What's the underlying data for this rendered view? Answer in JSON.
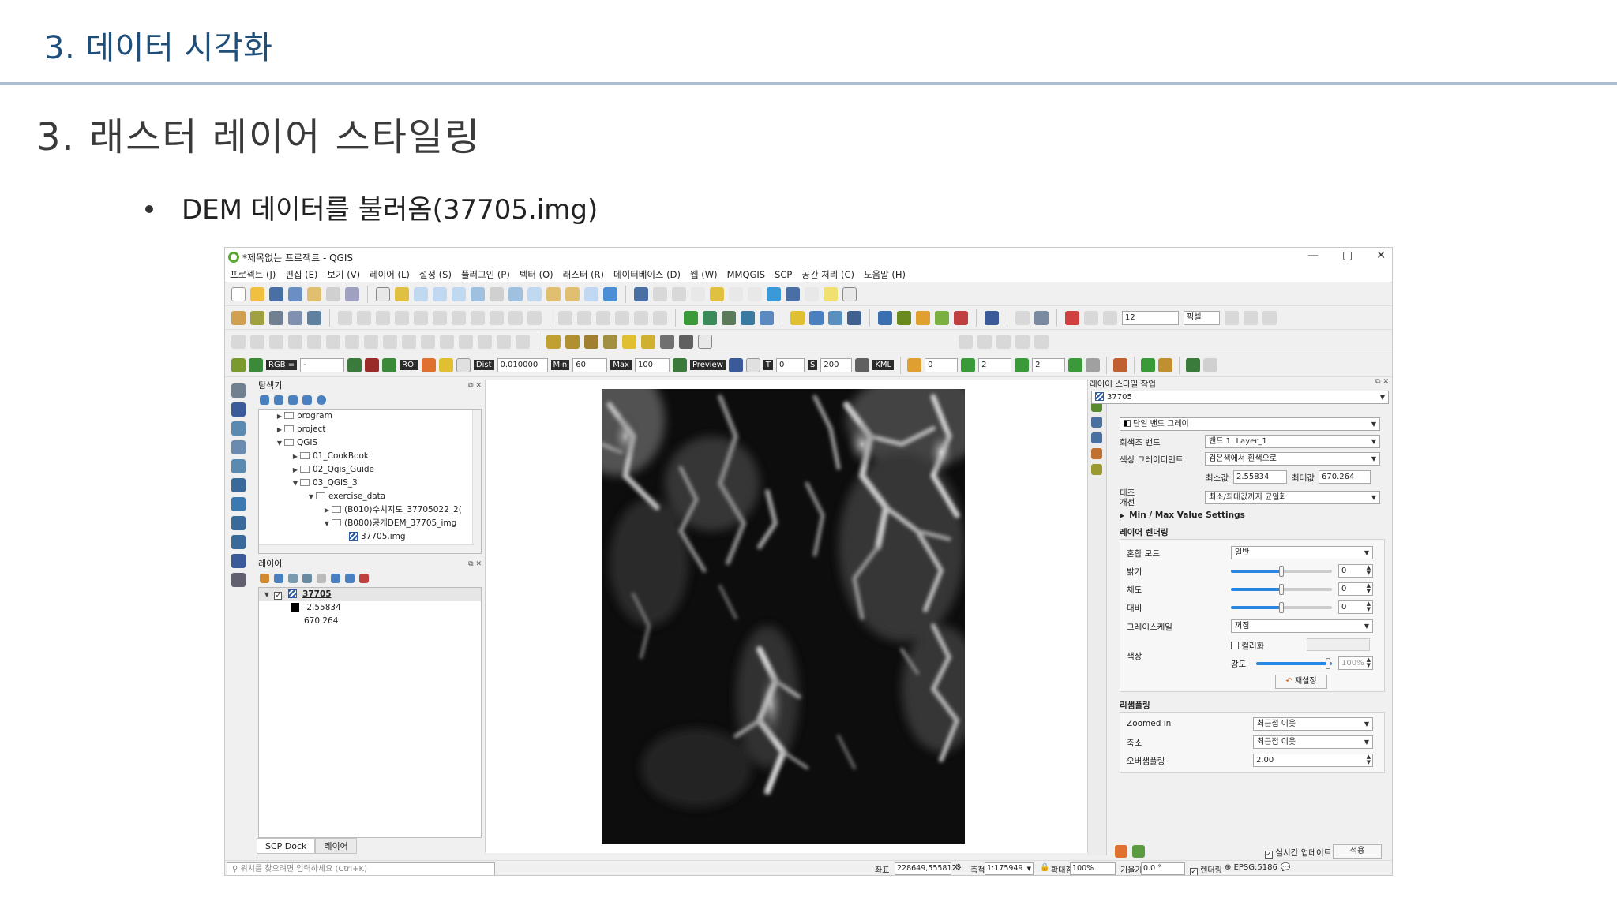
{
  "slide": {
    "title": "3. 데이터 시각화",
    "section": "3. 래스터 레이어 스타일링",
    "bullet": "DEM 데이터를 불러옴(37705.img)"
  },
  "window": {
    "title": "*제목없는 프로젝트 - QGIS",
    "controls": [
      "—",
      "▢",
      "✕"
    ]
  },
  "menu": [
    "프로젝트 (J)",
    "편집 (E)",
    "보기 (V)",
    "레이어 (L)",
    "설정 (S)",
    "플러그인 (P)",
    "벡터 (O)",
    "래스터 (R)",
    "데이터베이스 (D)",
    "웹 (W)",
    "MMQGIS",
    "SCP",
    "공간 처리 (C)",
    "도움말 (H)"
  ],
  "scp_toolbar": {
    "rgb_label": "RGB =",
    "rgb_value": "-",
    "roi_label": "ROI",
    "dist_label": "Dist",
    "dist_value": "0.010000",
    "min_label": "Min",
    "min_value": "60",
    "max_label": "Max",
    "max_value": "100",
    "preview_label": "Preview",
    "t_label": "T",
    "t_value": "0",
    "s_label": "S",
    "s_value": "200",
    "kml_label": "KML",
    "field1": "0",
    "field2": "2",
    "field3": "2"
  },
  "advanced_toolbar": {
    "size_value": "12",
    "unit_value": "픽셀"
  },
  "browser": {
    "title": "탐색기",
    "items": [
      {
        "label": "program",
        "depth": 0,
        "arrow": "▶"
      },
      {
        "label": "project",
        "depth": 0,
        "arrow": "▶"
      },
      {
        "label": "QGIS",
        "depth": 0,
        "arrow": "▼"
      },
      {
        "label": "01_CookBook",
        "depth": 1,
        "arrow": "▶"
      },
      {
        "label": "02_Qgis_Guide",
        "depth": 1,
        "arrow": "▶"
      },
      {
        "label": "03_QGIS_3",
        "depth": 1,
        "arrow": "▼"
      },
      {
        "label": "exercise_data",
        "depth": 2,
        "arrow": "▼"
      },
      {
        "label": "(B010)수치지도_37705022_2(",
        "depth": 3,
        "arrow": "▶"
      },
      {
        "label": "(B080)공개DEM_37705_img",
        "depth": 3,
        "arrow": "▼"
      },
      {
        "label": "37705.img",
        "depth": 4,
        "arrow": ""
      }
    ]
  },
  "layers": {
    "title": "레이어",
    "layer_name": "37705",
    "legend_min": "2.55834",
    "legend_max": "670.264"
  },
  "bottom_tabs": [
    "SCP Dock",
    "레이어"
  ],
  "style_panel": {
    "title": "레이어 스타일 작업",
    "layer": "37705",
    "renderer": "단일 밴드 그레이",
    "gray_band_label": "회색조 밴드",
    "gray_band_value": "밴드 1: Layer_1",
    "color_gradient_label": "색상 그레이디언트",
    "color_gradient_value": "검은색에서 흰색으로",
    "min_label": "최소값",
    "min_value": "2.55834",
    "max_label": "최대값",
    "max_value": "670.264",
    "contrast_label": "대조\n개선",
    "contrast_value": "최소/최대값까지 균일화",
    "minmax_settings": "Min / Max Value Settings",
    "rendering_title": "레이어 렌더링",
    "blend_label": "혼합 모드",
    "blend_value": "일반",
    "brightness_label": "밝기",
    "brightness_value": "0",
    "saturation_label": "채도",
    "saturation_value": "0",
    "contrast2_label": "대비",
    "contrast2_value": "0",
    "grayscale_label": "그레이스케일",
    "grayscale_value": "꺼짐",
    "hue_label": "색상",
    "colorize_label": "컬러화",
    "strength_label": "강도",
    "strength_value": "100%",
    "reset_label": "재설정",
    "resampling_title": "리샘플링",
    "zoomed_in_label": "Zoomed in",
    "zoomed_in_value": "최근접 이웃",
    "zoomed_out_label": "축소",
    "zoomed_out_value": "최근접 이웃",
    "oversampling_label": "오버샘플링",
    "oversampling_value": "2.00",
    "live_update_label": "실시간 업데이트",
    "apply_label": "적용"
  },
  "status": {
    "search_placeholder": "위치를 찾으려면 입력하세요 (Ctrl+K)",
    "coord_label": "좌표",
    "coord_value": "228649,555812",
    "scale_label": "축척",
    "scale_value": "1:175949",
    "magnifier_label": "확대경",
    "magnifier_value": "100%",
    "rotation_label": "기울기",
    "rotation_value": "0.0 °",
    "render_label": "렌더링",
    "crs": "EPSG:5186"
  }
}
